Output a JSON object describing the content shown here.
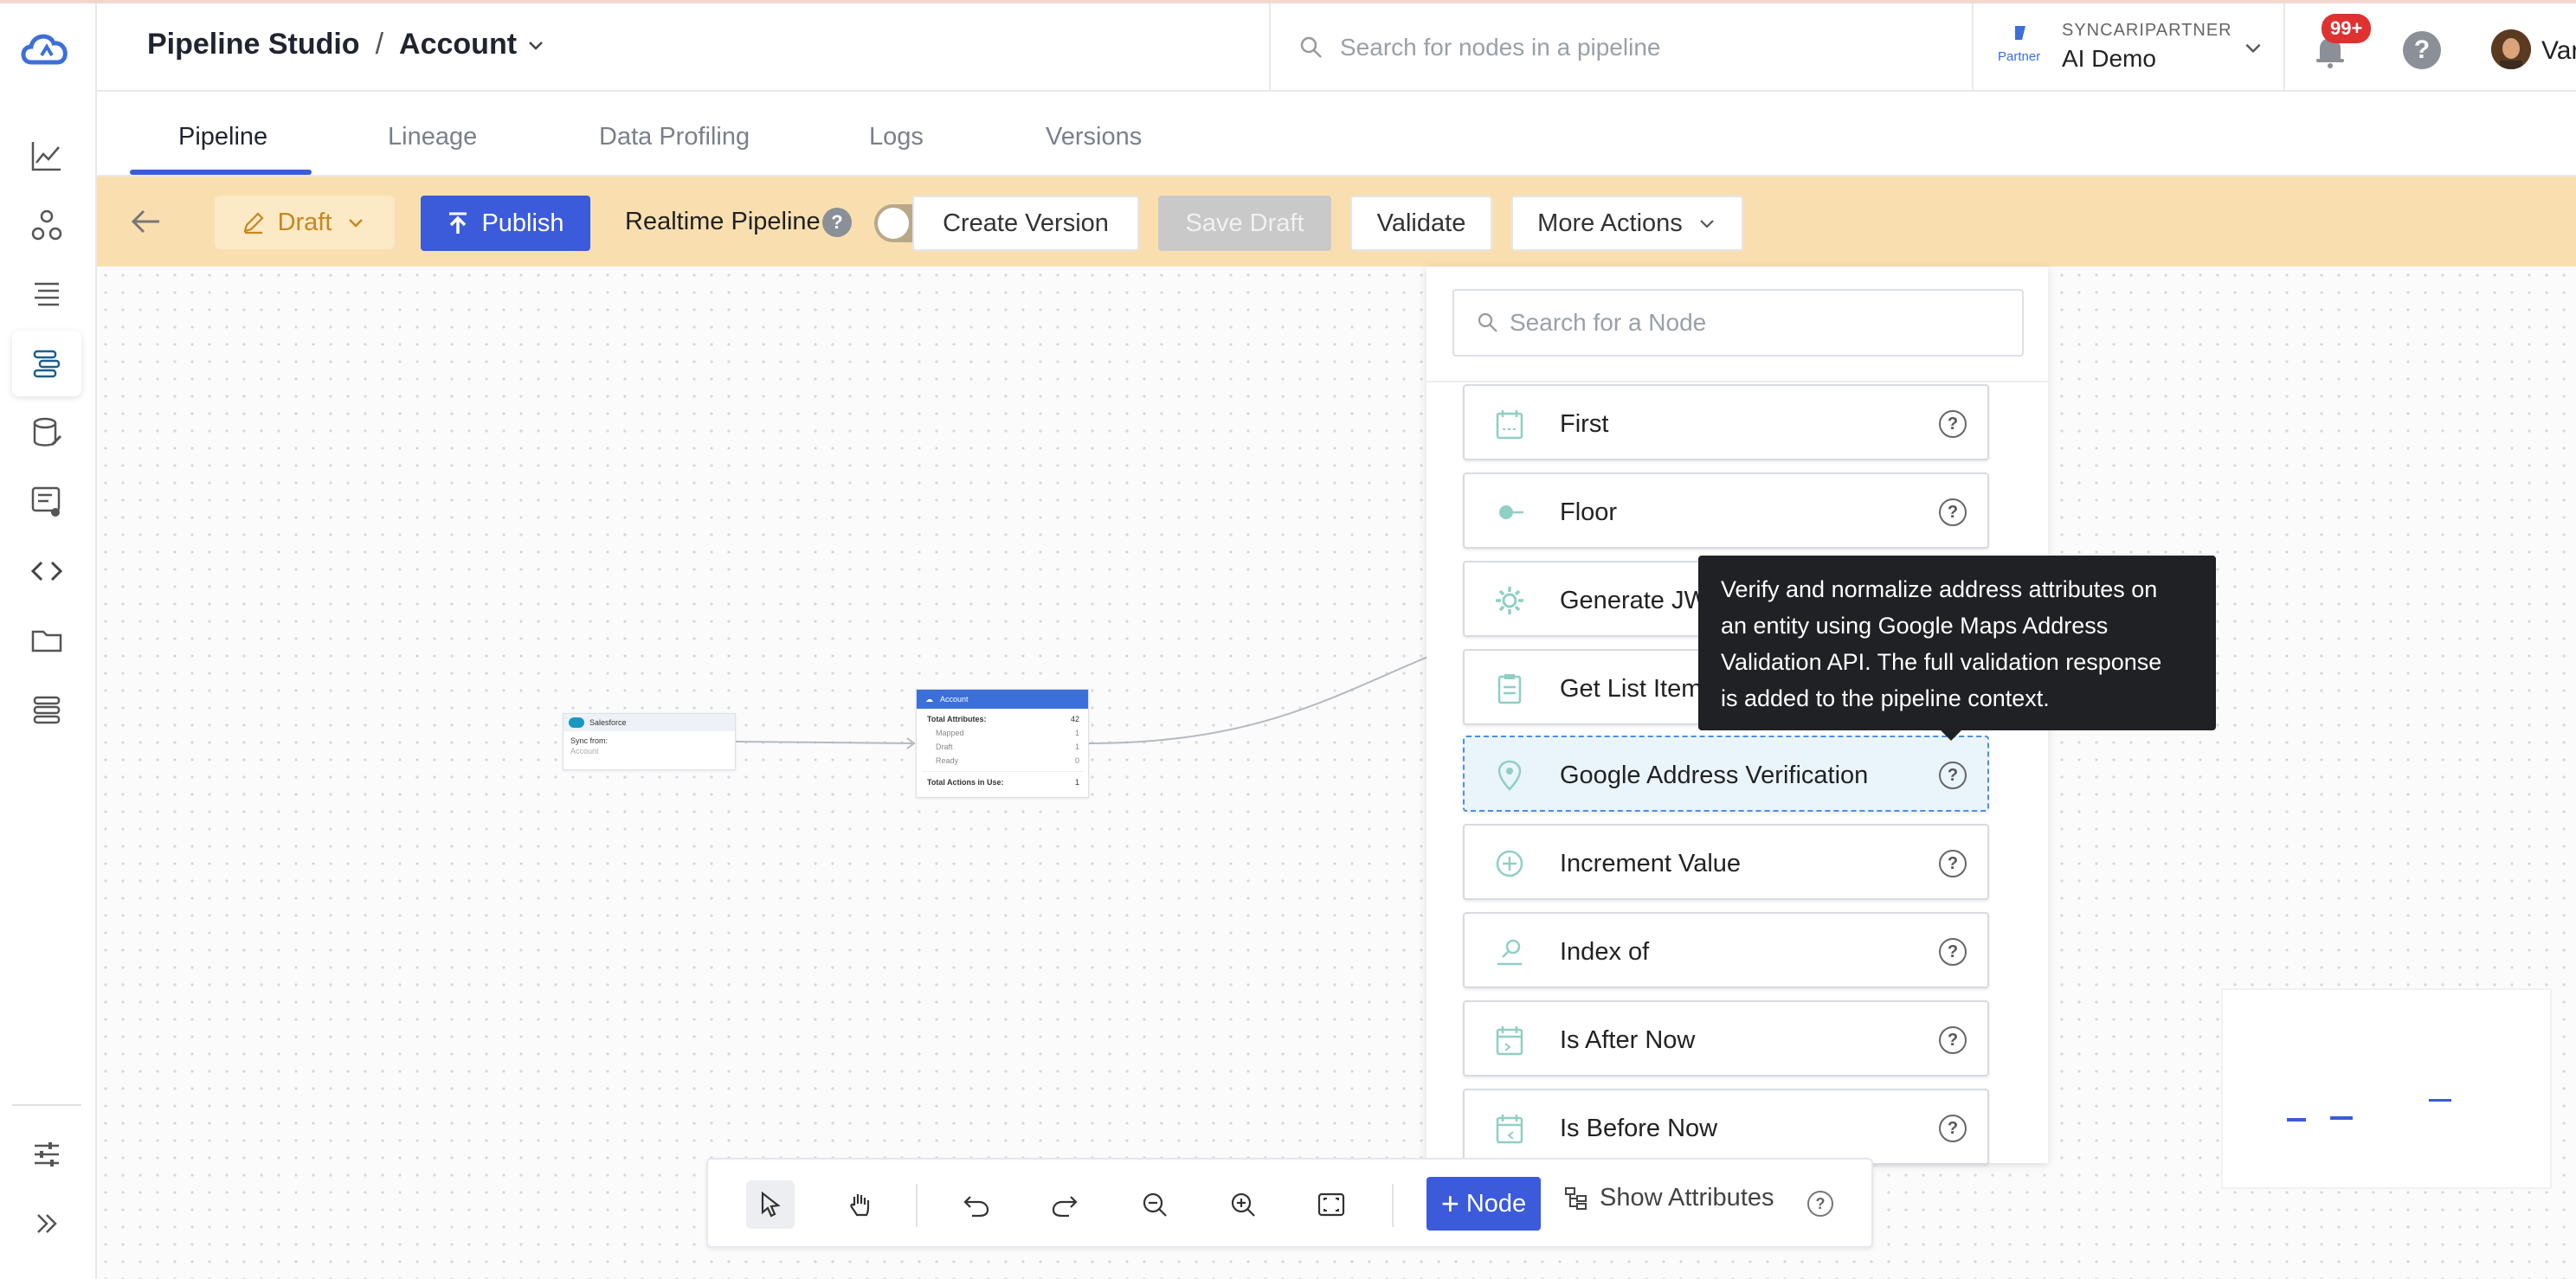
{
  "header": {
    "title": "Pipeline Studio",
    "separator": "/",
    "entity": "Account",
    "search_placeholder": "Search for nodes in a pipeline",
    "partner_label": "SYNCARIPARTNER",
    "partner_logo_text": "Partner",
    "org_name": "AI Demo",
    "notifications_badge": "99+",
    "help": "?",
    "user_name": "Varsha"
  },
  "tabs": [
    {
      "label": "Pipeline",
      "active": true
    },
    {
      "label": "Lineage"
    },
    {
      "label": "Data Profiling"
    },
    {
      "label": "Logs"
    },
    {
      "label": "Versions"
    }
  ],
  "toolbar": {
    "draft_label": "Draft",
    "publish_label": "Publish",
    "realtime_label": "Realtime Pipeline",
    "realtime_help": "?",
    "realtime_toggle": "✕",
    "create_version": "Create Version",
    "save_draft": "Save Draft",
    "validate": "Validate",
    "more_actions": "More Actions"
  },
  "canvas": {
    "source_node": {
      "title": "Salesforce",
      "row1": "Sync from:",
      "row2": "Account"
    },
    "entity_node": {
      "title": "Account",
      "total_attributes_label": "Total Attributes:",
      "total_attributes": "42",
      "mapped_label": "Mapped",
      "mapped": "1",
      "draft_label": "Draft",
      "draft": "1",
      "ready_label": "Ready",
      "ready": "0",
      "actions_label": "Total Actions in Use:",
      "actions": "1"
    }
  },
  "picker": {
    "search_placeholder": "Search for a Node",
    "items": [
      {
        "label": "First",
        "icon": "calendar-icon"
      },
      {
        "label": "Floor",
        "icon": "floor-icon"
      },
      {
        "label": "Generate JW",
        "icon": "gear-icon"
      },
      {
        "label": "Get List Item",
        "icon": "clipboard-icon"
      },
      {
        "label": "Google Address Verification",
        "icon": "location-pin-icon",
        "hovered": true
      },
      {
        "label": "Increment Value",
        "icon": "plus-circle-icon"
      },
      {
        "label": "Index of",
        "icon": "search-person-icon"
      },
      {
        "label": "Is After Now",
        "icon": "calendar-icon"
      },
      {
        "label": "Is Before Now",
        "icon": "calendar-icon"
      }
    ],
    "help": "?"
  },
  "tooltip": {
    "line1": "Verify and normalize address attributes on",
    "line2": "an entity using Google Maps Address",
    "line3": "Validation API. The full validation response",
    "line4": "is added to the pipeline context."
  },
  "bottom_bar": {
    "node_label": "Node",
    "show_attributes_label": "Show Attributes",
    "help": "?"
  },
  "colors": {
    "accent": "#3b5bdb",
    "toolbar_bg": "#f9dfb0",
    "tooltip_bg": "#202124",
    "badge": "#e03131"
  }
}
